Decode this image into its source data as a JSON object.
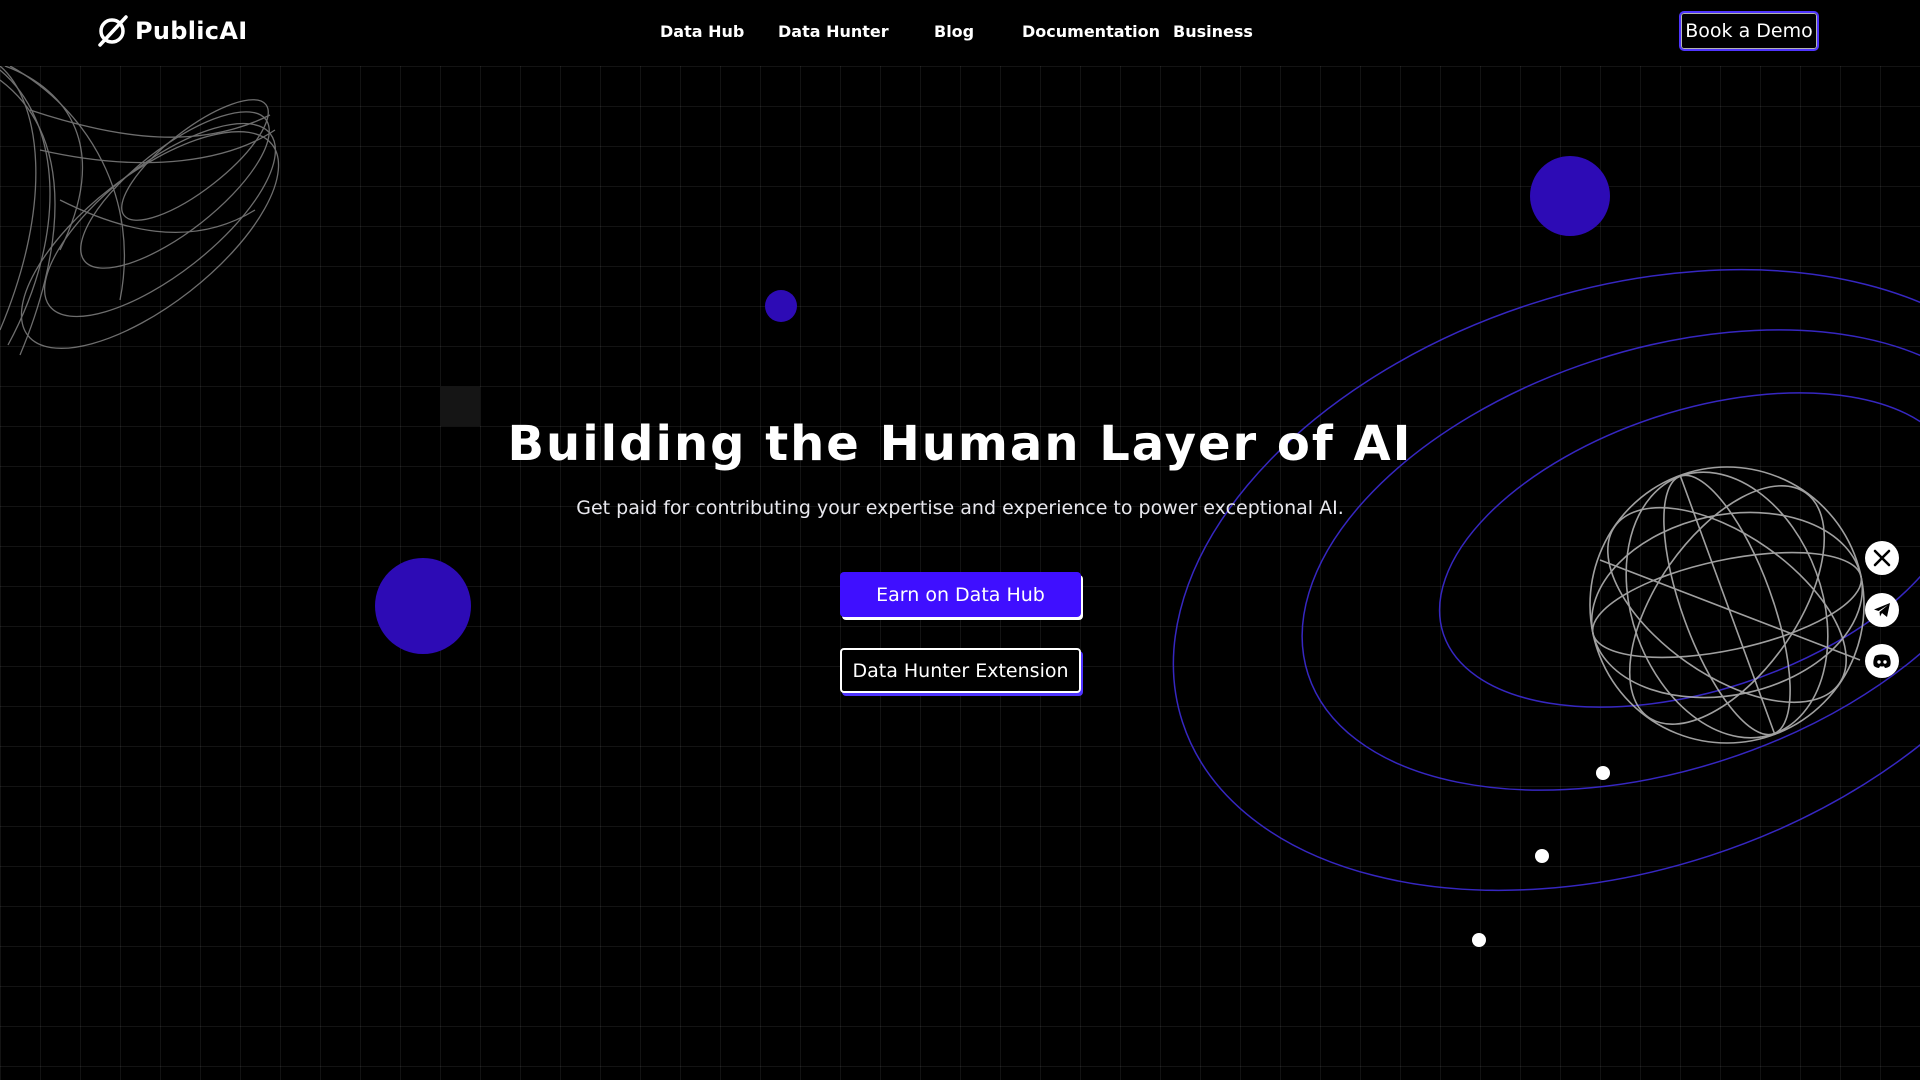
{
  "brand": {
    "name": "PublicAI"
  },
  "nav": {
    "items": [
      {
        "label": "Data Hub"
      },
      {
        "label": "Data Hunter"
      },
      {
        "label": "Blog"
      },
      {
        "label": "Documentation"
      },
      {
        "label": "Business"
      }
    ],
    "cta_label": "Book a Demo"
  },
  "hero": {
    "title": "Building the Human Layer of AI",
    "subtitle": "Get paid for contributing your expertise and experience to power exceptional AI.",
    "primary_label": "Earn on Data Hub",
    "secondary_label": "Data Hunter Extension"
  },
  "social": [
    {
      "icon": "x-icon"
    },
    {
      "icon": "telegram-icon"
    },
    {
      "icon": "discord-icon"
    }
  ],
  "colors": {
    "background": "#000000",
    "accent": "#3f0fff",
    "accent_dark": "#2d0bb5",
    "text": "#ffffff"
  }
}
